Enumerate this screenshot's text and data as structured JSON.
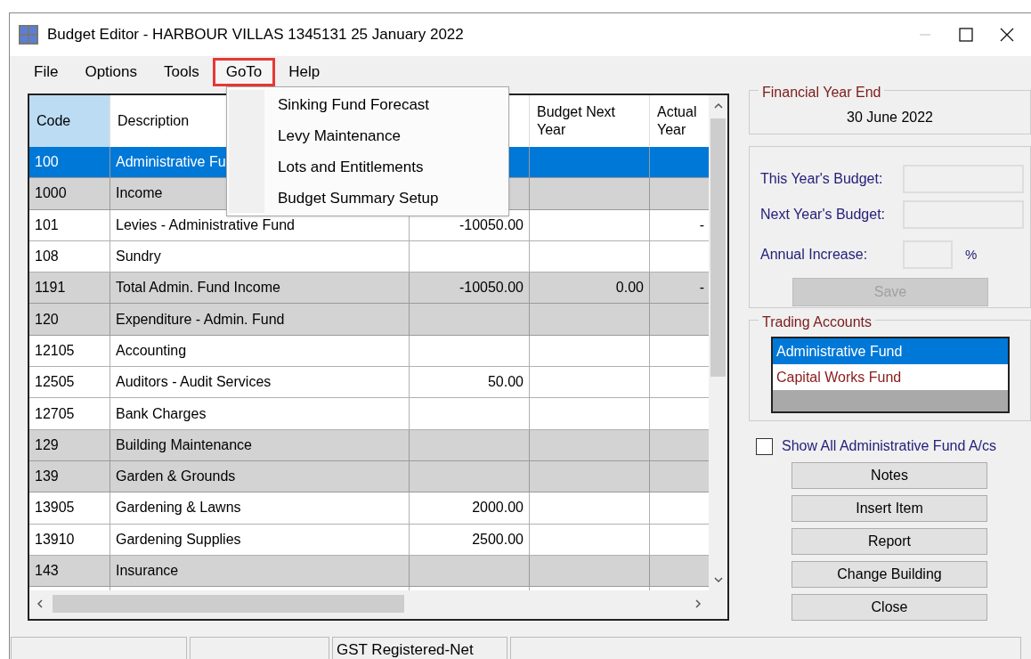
{
  "window": {
    "title": "Budget Editor - HARBOUR VILLAS 1345131 25 January 2022"
  },
  "menu_bar": [
    {
      "label": "File",
      "highlighted": false
    },
    {
      "label": "Options",
      "highlighted": false
    },
    {
      "label": "Tools",
      "highlighted": false
    },
    {
      "label": "GoTo",
      "highlighted": true
    },
    {
      "label": "Help",
      "highlighted": false
    }
  ],
  "open_menu": {
    "items": [
      "Sinking Fund Forecast",
      "Levy Maintenance",
      "Lots and Entitlements",
      "Budget Summary Setup"
    ]
  },
  "table": {
    "columns": [
      {
        "label": "Code",
        "selected": true
      },
      {
        "label": "Description",
        "selected": false
      },
      {
        "selected": false
      },
      {
        "label": "Budget Next Year",
        "selected": false
      },
      {
        "label": "Actual Year",
        "selected": false
      }
    ],
    "rows": [
      {
        "kind": "group",
        "selected": true,
        "cells": [
          "100",
          "Administrative Fu",
          "",
          "",
          ""
        ]
      },
      {
        "kind": "group",
        "selected": false,
        "cells": [
          "1000",
          "Income",
          "",
          "",
          ""
        ]
      },
      {
        "kind": "item",
        "selected": false,
        "cells": [
          "101",
          "Levies - Administrative Fund",
          "-10050.00",
          "",
          "-"
        ]
      },
      {
        "kind": "item",
        "selected": false,
        "cells": [
          "108",
          "Sundry",
          "",
          "",
          ""
        ]
      },
      {
        "kind": "group",
        "selected": false,
        "cells": [
          "1191",
          "Total Admin. Fund Income",
          "-10050.00",
          "0.00",
          "-"
        ]
      },
      {
        "kind": "group",
        "selected": false,
        "cells": [
          "120",
          "Expenditure - Admin. Fund",
          "",
          "",
          ""
        ]
      },
      {
        "kind": "item",
        "selected": false,
        "cells": [
          "12105",
          "Accounting",
          "",
          "",
          ""
        ]
      },
      {
        "kind": "item",
        "selected": false,
        "cells": [
          "12505",
          "Auditors - Audit Services",
          "50.00",
          "",
          ""
        ]
      },
      {
        "kind": "item",
        "selected": false,
        "cells": [
          "12705",
          "Bank Charges",
          "",
          "",
          ""
        ]
      },
      {
        "kind": "group",
        "selected": false,
        "cells": [
          "129",
          "Building Maintenance",
          "",
          "",
          ""
        ]
      },
      {
        "kind": "group",
        "selected": false,
        "cells": [
          "139",
          "Garden & Grounds",
          "",
          "",
          ""
        ]
      },
      {
        "kind": "item",
        "selected": false,
        "cells": [
          "13905",
          "Gardening & Lawns",
          "2000.00",
          "",
          ""
        ]
      },
      {
        "kind": "item",
        "selected": false,
        "cells": [
          "13910",
          "Gardening Supplies",
          "2500.00",
          "",
          ""
        ]
      },
      {
        "kind": "group",
        "selected": false,
        "cells": [
          "143",
          "Insurance",
          "",
          "",
          ""
        ]
      },
      {
        "kind": "item",
        "selected": false,
        "cells": [
          "",
          "",
          "",
          "",
          ""
        ]
      }
    ]
  },
  "financial_year_end": {
    "title": "Financial Year End",
    "value": "30 June 2022"
  },
  "budget_fields": [
    {
      "label": "This Year's Budget:",
      "kind": "wide"
    },
    {
      "label": "Next Year's Budget:",
      "kind": "wide"
    },
    {
      "label": "Annual Increase:",
      "kind": "percent",
      "suffix": "%"
    }
  ],
  "save_button": {
    "label": "Save",
    "disabled": true
  },
  "trading_accounts": {
    "title": "Trading Accounts",
    "items": [
      {
        "label": "Administrative Fund",
        "selected": true
      },
      {
        "label": "Capital Works Fund",
        "selected": false
      }
    ]
  },
  "show_all": {
    "label": "Show All Administrative Fund A/cs",
    "checked": false
  },
  "buttons": [
    "Notes",
    "Insert Item",
    "Report",
    "Change Building",
    "Close"
  ],
  "status_bar": [
    {
      "kind": "pane"
    },
    {
      "kind": "pane"
    },
    {
      "kind": "pane",
      "text": "GST Registered-Net"
    },
    {
      "kind": "pane"
    }
  ]
}
